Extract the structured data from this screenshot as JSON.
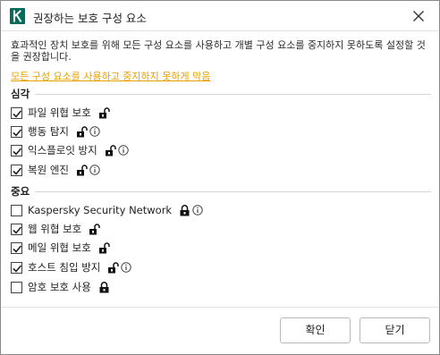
{
  "window": {
    "title": "권장하는 보호 구성 요소",
    "brand_color": "#006d5c"
  },
  "description": "효과적인 장치 보호를 위해 모든 구성 요소를 사용하고 개별 구성 요소를 중지하지 못하도록 설정할 것을 권장합니다.",
  "lock_all_link": "모든 구성 요소를 사용하고 중지하지 못하게 막음",
  "link_color": "#e8a000",
  "sections": [
    {
      "title": "심각",
      "items": [
        {
          "label": "파일 위협 보호",
          "checked": true,
          "lock": "open",
          "info": false
        },
        {
          "label": "행동 탐지",
          "checked": true,
          "lock": "open",
          "info": true
        },
        {
          "label": "익스플로잇 방지",
          "checked": true,
          "lock": "open",
          "info": true
        },
        {
          "label": "복원 엔진",
          "checked": true,
          "lock": "open",
          "info": true
        }
      ]
    },
    {
      "title": "중요",
      "items": [
        {
          "label": "Kaspersky Security Network",
          "checked": false,
          "lock": "closed",
          "info": true
        },
        {
          "label": "웹 위협 보호",
          "checked": true,
          "lock": "open",
          "info": false
        },
        {
          "label": "메일 위협 보호",
          "checked": true,
          "lock": "open",
          "info": false
        },
        {
          "label": "호스트 침입 방지",
          "checked": true,
          "lock": "open",
          "info": true
        },
        {
          "label": "암호 보호 사용",
          "checked": false,
          "lock": "closed",
          "info": false
        }
      ]
    }
  ],
  "buttons": {
    "ok": "확인",
    "cancel": "닫기"
  }
}
